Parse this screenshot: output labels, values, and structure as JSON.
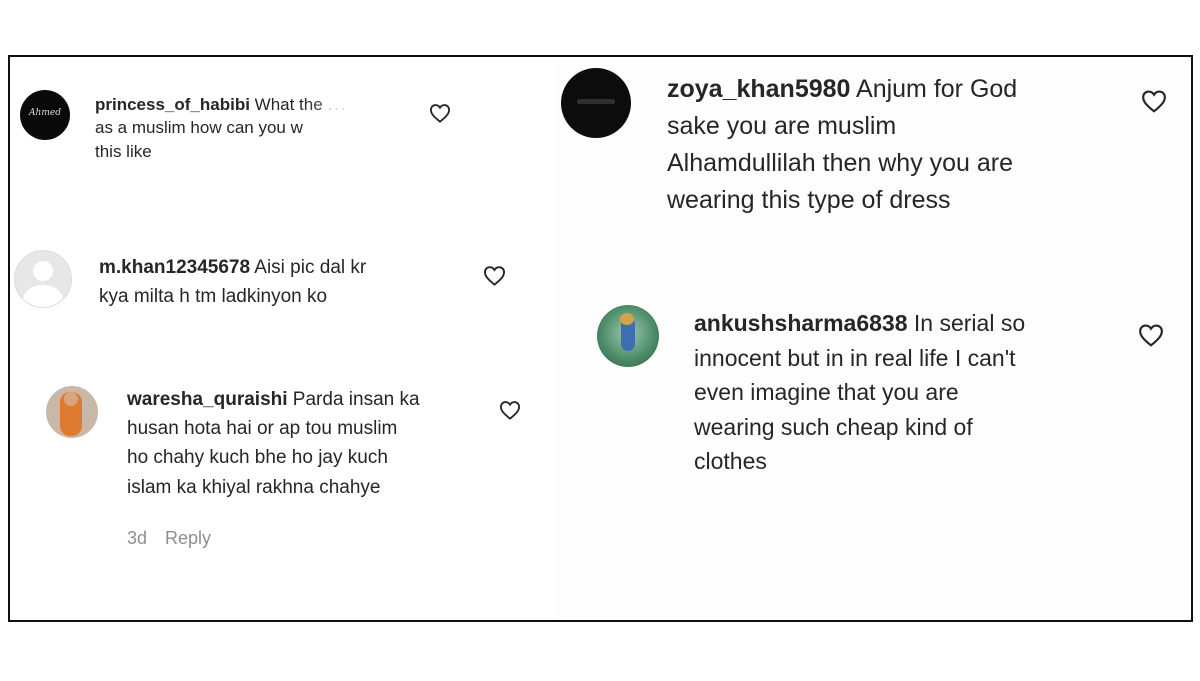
{
  "comments": [
    {
      "username": "princess_of_habibi",
      "text": "What the ... as a muslim how can you wear this like",
      "line1": " What the",
      "ellipsis": "...",
      "line2": "as a muslim how can you w",
      "line3": "this like",
      "avatar_text": "Ahmed"
    },
    {
      "username": "m.khan12345678",
      "line1": " Aisi pic dal kr",
      "line2": "kya milta h tm ladkinyon ko"
    },
    {
      "username": "waresha_quraishi",
      "line1": " Parda insan ka",
      "line2": "husan hota hai or ap tou muslim",
      "line3": "ho chahy kuch bhe ho jay kuch",
      "line4": "islam ka khiyal rakhna chahye",
      "time": "3d",
      "reply": "Reply"
    },
    {
      "username": "zoya_khan5980",
      "line1": " Anjum for God",
      "line2": "sake you are muslim",
      "line3": "Alhamdullilah then why you are",
      "line4": "wearing this type of dress"
    },
    {
      "username": "ankushsharma6838",
      "line1": " In serial so",
      "line2": "innocent but in in real life I can't",
      "line3": "even imagine that you are",
      "line4": "wearing such cheap kind of",
      "line5": "clothes"
    }
  ],
  "icons": {
    "like": "heart-outline-icon"
  },
  "colors": {
    "text": "#262626",
    "meta": "#8e8e8e",
    "border": "#111111"
  }
}
